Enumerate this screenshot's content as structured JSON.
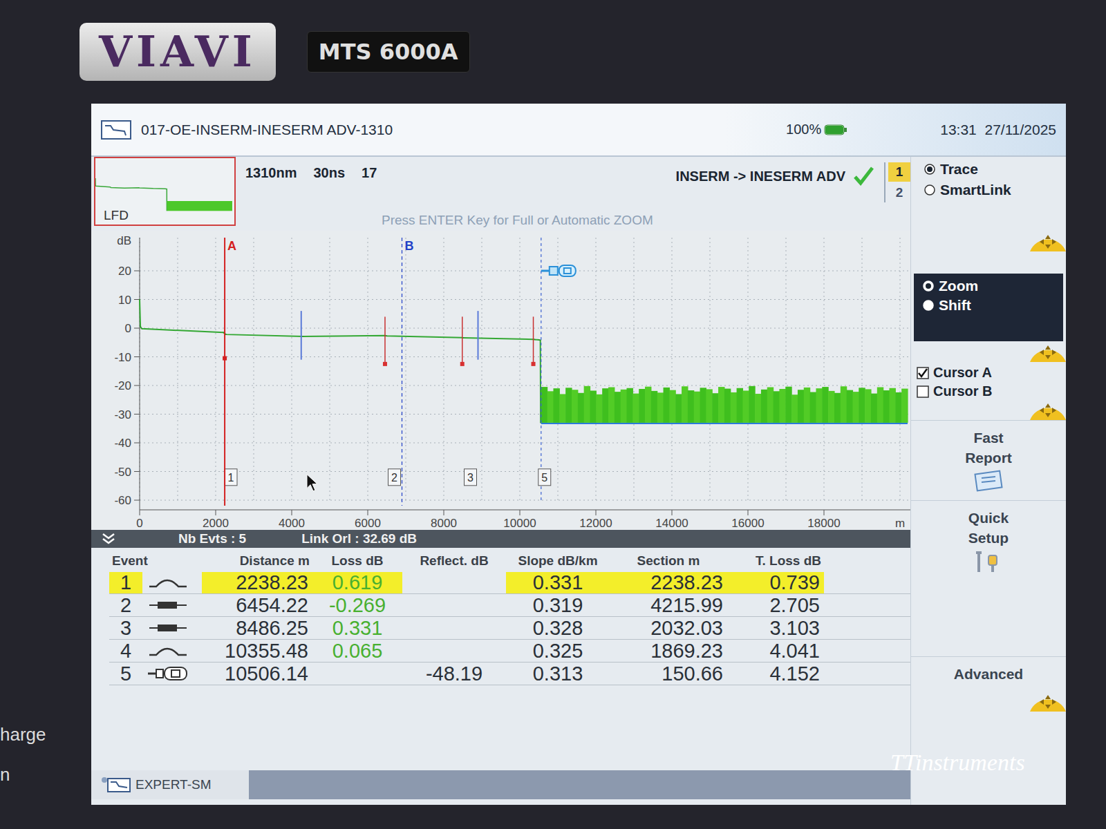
{
  "device": {
    "brand": "VIAVI",
    "model": "MTS 6000A",
    "side_labels": [
      "harge",
      "n"
    ]
  },
  "title_bar": {
    "title": "017-OE-INSERM-INESERM ADV-1310",
    "battery": "100%",
    "battery_level": 1.0,
    "time": "13:31  27/11/2025"
  },
  "trace_info": {
    "thumbnail_label": "LFD",
    "wavelength": "1310nm",
    "pulse": "30ns",
    "number": "17",
    "direction": "INSERM -> INESERM ADV",
    "status_ok": true,
    "hint": "Press ENTER Key for Full or Automatic ZOOM"
  },
  "trace_tabs": [
    {
      "label": "1",
      "selected": true
    },
    {
      "label": "2",
      "selected": false
    }
  ],
  "view_modes": [
    {
      "label": "Trace",
      "selected": true
    },
    {
      "label": "SmartLink",
      "selected": false
    }
  ],
  "zoom_modes": [
    {
      "label": "Zoom",
      "selected": true
    },
    {
      "label": "Shift",
      "selected": false
    }
  ],
  "cursors": [
    {
      "label": "Cursor A",
      "checked": true
    },
    {
      "label": "Cursor B",
      "checked": false
    }
  ],
  "actions": [
    {
      "label": "Fast Report"
    },
    {
      "label": "Quick Setup"
    },
    {
      "label": "Advanced"
    }
  ],
  "chart": {
    "y_unit": "dB",
    "x_unit": "m",
    "y_ticks": [
      {
        "label": "20",
        "value": 20
      },
      {
        "label": "10",
        "value": 10
      },
      {
        "label": "0",
        "value": 0
      },
      {
        "label": "-10",
        "value": -10
      },
      {
        "label": "-20",
        "value": -20
      },
      {
        "label": "-30",
        "value": -30
      },
      {
        "label": "-40",
        "value": -40
      },
      {
        "label": "-50",
        "value": -50
      },
      {
        "label": "-60",
        "value": -60
      }
    ],
    "x_ticks": [
      {
        "label": "0",
        "value": 0
      },
      {
        "label": "2000",
        "value": 2000
      },
      {
        "label": "4000",
        "value": 4000
      },
      {
        "label": "6000",
        "value": 6000
      },
      {
        "label": "8000",
        "value": 8000
      },
      {
        "label": "10000",
        "value": 10000
      },
      {
        "label": "12000",
        "value": 12000
      },
      {
        "label": "14000",
        "value": 14000
      },
      {
        "label": "16000",
        "value": 16000
      },
      {
        "label": "18000",
        "value": 18000
      }
    ],
    "trace": {
      "distance": [
        0,
        20,
        60,
        2200,
        2238,
        2270,
        4300,
        6454,
        6500,
        8486,
        8520,
        10355,
        10400,
        10506,
        10540,
        10548
      ],
      "db": [
        10,
        0.5,
        -0.2,
        -1.5,
        -1.9,
        -2.2,
        -2.9,
        -2.6,
        -2.7,
        -3.3,
        -3.4,
        -3.9,
        -4.0,
        -4.1,
        -4.2,
        -33
      ]
    },
    "noise": {
      "distance_start": 10560,
      "distance_end": 20200,
      "bottom": -33,
      "top": [
        -20.5,
        -22,
        -21,
        -23,
        -20.8,
        -21.5,
        -22.6,
        -20.2,
        -21.8,
        -23.1,
        -21,
        -20.6,
        -22.2,
        -21.4,
        -20.9,
        -22.8,
        -21.2,
        -20.4,
        -21.9,
        -22.5,
        -20.7,
        -21.6,
        -23,
        -20.3,
        -21.7,
        -22.1,
        -20.8,
        -21.3,
        -22.7,
        -20.5,
        -21.1,
        -22.4,
        -20.9,
        -21.8,
        -20.2,
        -22.9,
        -21.4,
        -20.6,
        -22,
        -21.2,
        -20.4,
        -23.2,
        -21.5,
        -20.7,
        -22.3,
        -21,
        -20.5,
        -21.9,
        -22.6,
        -20.3,
        -21.6,
        -22.2,
        -20.8,
        -21.3,
        -22.8,
        -20.6,
        -21.7,
        -20.9,
        -22.4,
        -21.1
      ]
    },
    "cursors": [
      {
        "label": "A",
        "distance": 2238,
        "color": "#d42020"
      },
      {
        "label": "B",
        "distance": 6900,
        "color": "#2040c8"
      }
    ],
    "event_markers": [
      {
        "label": "1",
        "distance": 2238,
        "label_distance": 2400,
        "tick": false
      },
      {
        "label": "2",
        "distance": 6454,
        "label_distance": 6700,
        "tick": true
      },
      {
        "label": "3",
        "distance": 8486,
        "label_distance": 8700,
        "tick": true
      },
      {
        "distance": 10355,
        "tick": true
      },
      {
        "label": "5",
        "distance": 10560,
        "label_distance": 10650,
        "tick": false
      }
    ],
    "extra_markers": [
      {
        "distance": 4250
      },
      {
        "distance": 8900
      }
    ]
  },
  "summary": {
    "events": "Nb Evts : 5",
    "orl": "Link Orl : 32.69 dB"
  },
  "table": {
    "columns": [
      "Event",
      "Distance  m",
      "Loss dB",
      "Reflect. dB",
      "Slope  dB/km",
      "Section m",
      "T. Loss dB"
    ],
    "rows": [
      {
        "event": "1",
        "kind": "bend",
        "distance": "2238.23",
        "loss": "0.619",
        "reflect": "",
        "slope": "0.331",
        "section": "2238.23",
        "total": "0.739",
        "selected": true
      },
      {
        "event": "2",
        "kind": "splice",
        "distance": "6454.22",
        "loss": "-0.269",
        "reflect": "",
        "slope": "0.319",
        "section": "4215.99",
        "total": "2.705",
        "selected": false
      },
      {
        "event": "3",
        "kind": "splice",
        "distance": "8486.25",
        "loss": "0.331",
        "reflect": "",
        "slope": "0.328",
        "section": "2032.03",
        "total": "3.103",
        "selected": false
      },
      {
        "event": "4",
        "kind": "bend",
        "distance": "10355.48",
        "loss": "0.065",
        "reflect": "",
        "slope": "0.325",
        "section": "1869.23",
        "total": "4.041",
        "selected": false
      },
      {
        "event": "5",
        "kind": "end",
        "distance": "10506.14",
        "loss": "",
        "reflect": "-48.19",
        "slope": "0.313",
        "section": "150.66",
        "total": "4.152",
        "selected": false
      }
    ]
  },
  "bottom_bar": {
    "label": "EXPERT-SM"
  },
  "watermark": "TTinstruments"
}
